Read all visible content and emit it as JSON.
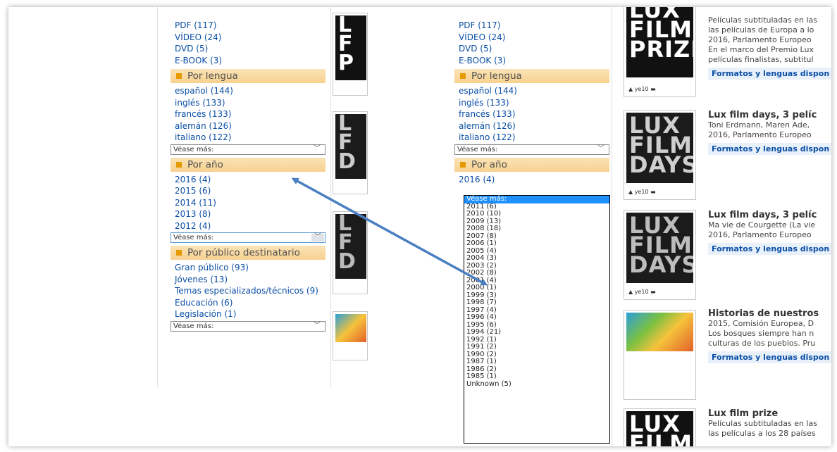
{
  "left": {
    "formats": [
      "PDF (117)",
      "VÍDEO (24)",
      "DVD (5)",
      "E-BOOK (3)"
    ],
    "lang_head": "Por lengua",
    "languages": [
      "español (144)",
      "inglés (133)",
      "francés (133)",
      "alemán (126)",
      "italiano (122)"
    ],
    "see_more": "Véase más:",
    "year_head": "Por año",
    "years": [
      "2016 (4)",
      "2015 (6)",
      "2014 (11)",
      "2013 (8)",
      "2012 (4)"
    ],
    "audience_head": "Por público destinatario",
    "audiences": [
      "Gran público (93)",
      "Jóvenes (13)",
      "Temas especializados/técnicos (9)",
      "Educación (6)",
      "Legislación (1)"
    ]
  },
  "right": {
    "formats": [
      "PDF (117)",
      "VÍDEO (24)",
      "DVD (5)",
      "E-BOOK (3)"
    ],
    "lang_head": "Por lengua",
    "languages": [
      "español (144)",
      "inglés (133)",
      "francés (133)",
      "alemán (126)",
      "italiano (122)"
    ],
    "see_more": "Véase más:",
    "year_head": "Por año",
    "year_first": "2016 (4)",
    "dropdown_options": [
      "Véase más:",
      "2011 (6)",
      "2010 (10)",
      "2009 (13)",
      "2008 (18)",
      "2007 (8)",
      "2006 (1)",
      "2005 (4)",
      "2004 (3)",
      "2003 (2)",
      "2002 (8)",
      "2001 (4)",
      "2000 (1)",
      "1999 (3)",
      "1998 (7)",
      "1997 (4)",
      "1996 (4)",
      "1995 (6)",
      "1994 (21)",
      "1992 (1)",
      "1991 (2)",
      "1990 (2)",
      "1987 (1)",
      "1986 (2)",
      "1985 (1)",
      "Unknown (5)"
    ]
  },
  "covers": {
    "lux_prize": [
      "LUX",
      "FILM",
      "PRIZE"
    ],
    "lux_days": [
      "LUX",
      "FILM",
      "DAYS"
    ]
  },
  "results": [
    {
      "lines": [
        "Películas subtituladas en las",
        "las películas de Europa a lo",
        "2016, Parlamento Europeo",
        "En el marco del Premio Lux",
        "películas finalistas, subtitul"
      ],
      "link": "Formatos y lenguas dispon"
    },
    {
      "title": "Lux film days, 3 pelíc",
      "lines": [
        "Toni Erdmann, Maren Ade,",
        "2016, Parlamento Europeo"
      ],
      "link": "Formatos y lenguas dispon"
    },
    {
      "title": "Lux film days, 3 pelíc",
      "lines": [
        "Ma vie de Courgette (La vie",
        "2016, Parlamento Europeo"
      ],
      "link": "Formatos y lenguas dispon"
    },
    {
      "title": "Historias de nuestros",
      "lines": [
        "2015, Comisión Europea, D",
        "Los bosques siempre han n",
        "culturas de los pueblos. Pru"
      ],
      "link": "Formatos y lenguas dispon"
    },
    {
      "title": "Lux film prize",
      "lines": [
        "Películas subtituladas en las",
        "las películas a los 28 países"
      ]
    }
  ],
  "colors": {
    "link": "#0b4fa6",
    "facet_head": "#f7d18e",
    "arrow": "#4a7fc1",
    "selected": "#1e90ff"
  }
}
